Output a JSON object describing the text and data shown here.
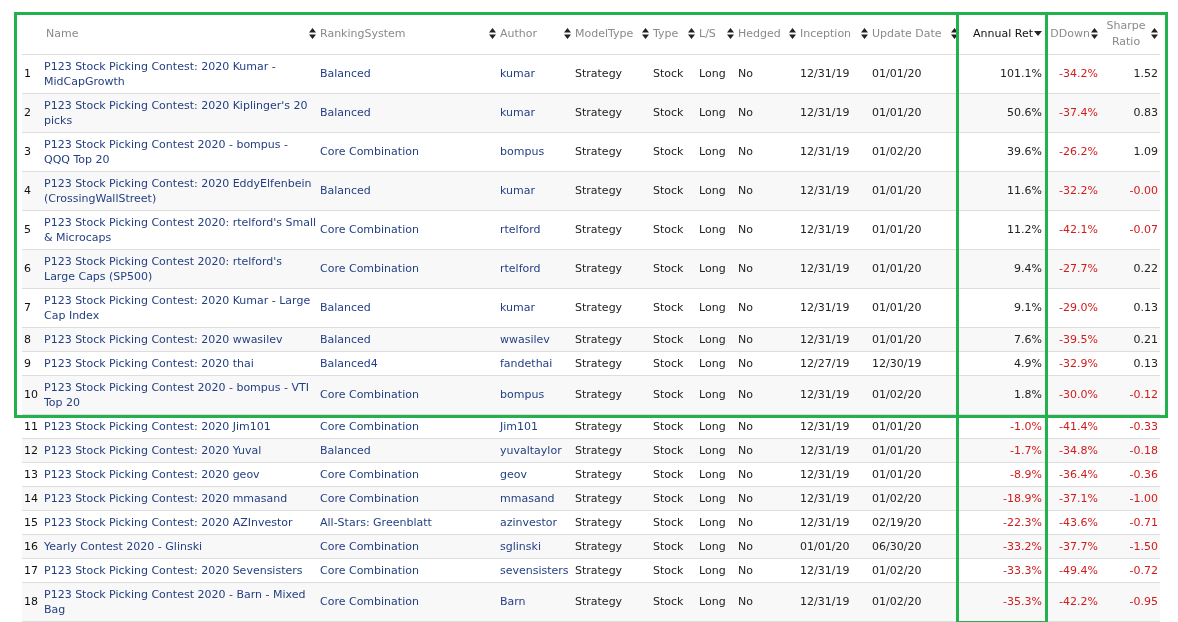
{
  "table": {
    "columns": [
      {
        "label": "Name",
        "sorted": false,
        "kind": "link",
        "highlighted": false
      },
      {
        "label": "RankingSystem",
        "sorted": false,
        "kind": "link",
        "highlighted": false
      },
      {
        "label": "Author",
        "sorted": false,
        "kind": "link",
        "highlighted": false
      },
      {
        "label": "ModelType",
        "sorted": false,
        "kind": "text",
        "highlighted": false
      },
      {
        "label": "Type",
        "sorted": false,
        "kind": "text",
        "highlighted": false
      },
      {
        "label": "L/S",
        "sorted": false,
        "kind": "text",
        "highlighted": false
      },
      {
        "label": "Hedged",
        "sorted": false,
        "kind": "text",
        "highlighted": false
      },
      {
        "label": "Inception",
        "sorted": false,
        "kind": "text",
        "highlighted": false
      },
      {
        "label": "Update Date",
        "sorted": false,
        "kind": "text",
        "highlighted": false
      },
      {
        "label": "Annual Ret",
        "sorted": true,
        "kind": "metric",
        "highlighted": true
      },
      {
        "label": "DDown",
        "sorted": false,
        "kind": "metric",
        "highlighted": false
      },
      {
        "label": "Sharpe Ratio",
        "sorted": false,
        "kind": "metric",
        "highlighted": false
      }
    ],
    "row_groups": [
      {
        "highlighted": true,
        "rows": [
          {
            "rank": "1",
            "cells": [
              "P123 Stock Picking Contest: 2020 Kumar - MidCapGrowth",
              "Balanced",
              "kumar",
              "Strategy",
              "Stock",
              "Long",
              "No",
              "12/31/19",
              "01/01/20",
              {
                "text": "101.1%",
                "negative": false
              },
              {
                "text": "-34.2%",
                "negative": true
              },
              {
                "text": "1.52",
                "negative": false
              }
            ]
          },
          {
            "rank": "2",
            "cells": [
              "P123 Stock Picking Contest: 2020 Kiplinger's 20 picks",
              "Balanced",
              "kumar",
              "Strategy",
              "Stock",
              "Long",
              "No",
              "12/31/19",
              "01/01/20",
              {
                "text": "50.6%",
                "negative": false
              },
              {
                "text": "-37.4%",
                "negative": true
              },
              {
                "text": "0.83",
                "negative": false
              }
            ]
          },
          {
            "rank": "3",
            "cells": [
              "P123 Stock Picking Contest 2020 - bompus - QQQ Top 20",
              "Core Combination",
              "bompus",
              "Strategy",
              "Stock",
              "Long",
              "No",
              "12/31/19",
              "01/02/20",
              {
                "text": "39.6%",
                "negative": false
              },
              {
                "text": "-26.2%",
                "negative": true
              },
              {
                "text": "1.09",
                "negative": false
              }
            ]
          },
          {
            "rank": "4",
            "cells": [
              "P123 Stock Picking Contest: 2020 EddyElfenbein (CrossingWallStreet)",
              "Balanced",
              "kumar",
              "Strategy",
              "Stock",
              "Long",
              "No",
              "12/31/19",
              "01/01/20",
              {
                "text": "11.6%",
                "negative": false
              },
              {
                "text": "-32.2%",
                "negative": true
              },
              {
                "text": "-0.00",
                "negative": true
              }
            ]
          },
          {
            "rank": "5",
            "cells": [
              "P123 Stock Picking Contest 2020: rtelford's Small & Microcaps",
              "Core Combination",
              "rtelford",
              "Strategy",
              "Stock",
              "Long",
              "No",
              "12/31/19",
              "01/01/20",
              {
                "text": "11.2%",
                "negative": false
              },
              {
                "text": "-42.1%",
                "negative": true
              },
              {
                "text": "-0.07",
                "negative": true
              }
            ]
          },
          {
            "rank": "6",
            "cells": [
              "P123 Stock Picking Contest 2020: rtelford's Large Caps (SP500)",
              "Core Combination",
              "rtelford",
              "Strategy",
              "Stock",
              "Long",
              "No",
              "12/31/19",
              "01/01/20",
              {
                "text": "9.4%",
                "negative": false
              },
              {
                "text": "-27.7%",
                "negative": true
              },
              {
                "text": "0.22",
                "negative": false
              }
            ]
          },
          {
            "rank": "7",
            "cells": [
              "P123 Stock Picking Contest: 2020 Kumar - Large Cap Index",
              "Balanced",
              "kumar",
              "Strategy",
              "Stock",
              "Long",
              "No",
              "12/31/19",
              "01/01/20",
              {
                "text": "9.1%",
                "negative": false
              },
              {
                "text": "-29.0%",
                "negative": true
              },
              {
                "text": "0.13",
                "negative": false
              }
            ]
          },
          {
            "rank": "8",
            "cells": [
              "P123 Stock Picking Contest: 2020 wwasilev",
              "Balanced",
              "wwasilev",
              "Strategy",
              "Stock",
              "Long",
              "No",
              "12/31/19",
              "01/01/20",
              {
                "text": "7.6%",
                "negative": false
              },
              {
                "text": "-39.5%",
                "negative": true
              },
              {
                "text": "0.21",
                "negative": false
              }
            ]
          },
          {
            "rank": "9",
            "cells": [
              "P123 Stock Picking Contest: 2020 thai",
              "Balanced4",
              "fandethai",
              "Strategy",
              "Stock",
              "Long",
              "No",
              "12/27/19",
              "12/30/19",
              {
                "text": "4.9%",
                "negative": false
              },
              {
                "text": "-32.9%",
                "negative": true
              },
              {
                "text": "0.13",
                "negative": false
              }
            ]
          },
          {
            "rank": "10",
            "cells": [
              "P123 Stock Picking Contest 2020 - bompus - VTI Top 20",
              "Core Combination",
              "bompus",
              "Strategy",
              "Stock",
              "Long",
              "No",
              "12/31/19",
              "01/02/20",
              {
                "text": "1.8%",
                "negative": false
              },
              {
                "text": "-30.0%",
                "negative": true
              },
              {
                "text": "-0.12",
                "negative": true
              }
            ]
          }
        ]
      },
      {
        "highlighted": false,
        "rows": [
          {
            "rank": "11",
            "cells": [
              "P123 Stock Picking Contest: 2020 Jim101",
              "Core Combination",
              "Jim101",
              "Strategy",
              "Stock",
              "Long",
              "No",
              "12/31/19",
              "01/01/20",
              {
                "text": "-1.0%",
                "negative": true
              },
              {
                "text": "-41.4%",
                "negative": true
              },
              {
                "text": "-0.33",
                "negative": true
              }
            ]
          },
          {
            "rank": "12",
            "cells": [
              "P123 Stock Picking Contest: 2020 Yuval",
              "Balanced",
              "yuvaltaylor",
              "Strategy",
              "Stock",
              "Long",
              "No",
              "12/31/19",
              "01/01/20",
              {
                "text": "-1.7%",
                "negative": true
              },
              {
                "text": "-34.8%",
                "negative": true
              },
              {
                "text": "-0.18",
                "negative": true
              }
            ]
          },
          {
            "rank": "13",
            "cells": [
              "P123 Stock Picking Contest: 2020 geov",
              "Core Combination",
              "geov",
              "Strategy",
              "Stock",
              "Long",
              "No",
              "12/31/19",
              "01/01/20",
              {
                "text": "-8.9%",
                "negative": true
              },
              {
                "text": "-36.4%",
                "negative": true
              },
              {
                "text": "-0.36",
                "negative": true
              }
            ]
          },
          {
            "rank": "14",
            "cells": [
              "P123 Stock Picking Contest: 2020 mmasand",
              "Core Combination",
              "mmasand",
              "Strategy",
              "Stock",
              "Long",
              "No",
              "12/31/19",
              "01/02/20",
              {
                "text": "-18.9%",
                "negative": true
              },
              {
                "text": "-37.1%",
                "negative": true
              },
              {
                "text": "-1.00",
                "negative": true
              }
            ]
          },
          {
            "rank": "15",
            "cells": [
              "P123 Stock Picking Contest: 2020 AZInvestor",
              "All-Stars: Greenblatt",
              "azinvestor",
              "Strategy",
              "Stock",
              "Long",
              "No",
              "12/31/19",
              "02/19/20",
              {
                "text": "-22.3%",
                "negative": true
              },
              {
                "text": "-43.6%",
                "negative": true
              },
              {
                "text": "-0.71",
                "negative": true
              }
            ]
          },
          {
            "rank": "16",
            "cells": [
              "Yearly Contest 2020 - Glinski",
              "Core Combination",
              "sglinski",
              "Strategy",
              "Stock",
              "Long",
              "No",
              "01/01/20",
              "06/30/20",
              {
                "text": "-33.2%",
                "negative": true
              },
              {
                "text": "-37.7%",
                "negative": true
              },
              {
                "text": "-1.50",
                "negative": true
              }
            ]
          },
          {
            "rank": "17",
            "cells": [
              "P123 Stock Picking Contest: 2020 Sevensisters",
              "Core Combination",
              "sevensisters",
              "Strategy",
              "Stock",
              "Long",
              "No",
              "12/31/19",
              "01/02/20",
              {
                "text": "-33.3%",
                "negative": true
              },
              {
                "text": "-49.4%",
                "negative": true
              },
              {
                "text": "-0.72",
                "negative": true
              }
            ]
          },
          {
            "rank": "18",
            "cells": [
              "P123 Stock Picking Contest 2020 - Barn - Mixed Bag",
              "Core Combination",
              "Barn",
              "Strategy",
              "Stock",
              "Long",
              "No",
              "12/31/19",
              "01/02/20",
              {
                "text": "-35.3%",
                "negative": true
              },
              {
                "text": "-42.2%",
                "negative": true
              },
              {
                "text": "-0.95",
                "negative": true
              }
            ]
          }
        ]
      }
    ]
  }
}
